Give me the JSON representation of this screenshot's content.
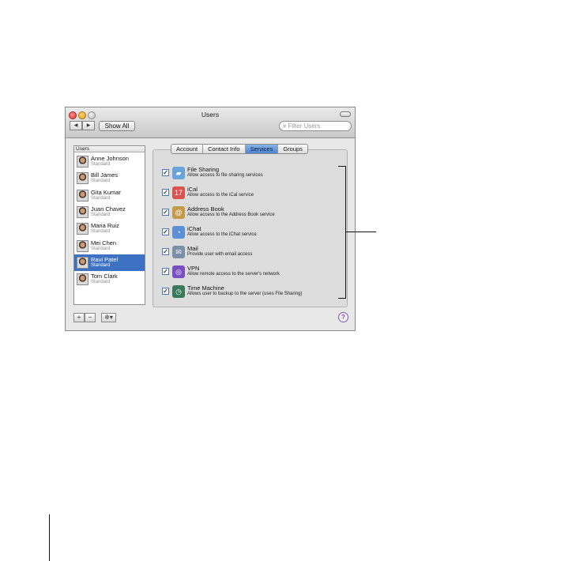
{
  "window": {
    "title": "Users",
    "show_all_label": "Show All",
    "back_glyph": "◀",
    "forward_glyph": "▶",
    "search_placeholder": "Filter Users",
    "search_icon": "magnifier-icon"
  },
  "user_list": {
    "header": "Users",
    "selected_index": 6,
    "users": [
      {
        "name": "Anne Johnson",
        "role": "Standard"
      },
      {
        "name": "Bill James",
        "role": "Standard"
      },
      {
        "name": "Gita Kumar",
        "role": "Standard"
      },
      {
        "name": "Juan Chavez",
        "role": "Standard"
      },
      {
        "name": "Maria Ruiz",
        "role": "Standard"
      },
      {
        "name": "Mei Chen",
        "role": "Standard"
      },
      {
        "name": "Ravi Patel",
        "role": "Standard"
      },
      {
        "name": "Tom Clark",
        "role": "Standard"
      }
    ]
  },
  "tabs": {
    "items": [
      "Account",
      "Contact Info",
      "Services",
      "Groups"
    ],
    "active": "Services"
  },
  "services": [
    {
      "name": "File Sharing",
      "desc": "Allow access to file sharing services",
      "checked": true,
      "icon": "folder-icon",
      "color": "#6aa3d9"
    },
    {
      "name": "iCal",
      "desc": "Allow access to the iCal service",
      "checked": true,
      "icon": "calendar-icon",
      "color": "#d9534f"
    },
    {
      "name": "Address Book",
      "desc": "Allow access to the Address Book service",
      "checked": true,
      "icon": "address-book-icon",
      "color": "#c49a4a"
    },
    {
      "name": "iChat",
      "desc": "Allow access to the iChat service",
      "checked": true,
      "icon": "chat-bubble-icon",
      "color": "#5b8fd8"
    },
    {
      "name": "Mail",
      "desc": "Provide user with email access",
      "checked": true,
      "icon": "mail-icon",
      "color": "#7a8fa8"
    },
    {
      "name": "VPN",
      "desc": "Allow remote access to the server's network",
      "checked": true,
      "icon": "vpn-icon",
      "color": "#7a4fc2"
    },
    {
      "name": "Time Machine",
      "desc": "Allows user to backup to the server (uses File Sharing)",
      "checked": true,
      "icon": "time-machine-icon",
      "color": "#3a7a5a"
    }
  ],
  "bottom_bar": {
    "add_glyph": "+",
    "remove_glyph": "−",
    "action_glyph": "✲▾",
    "help_glyph": "?"
  },
  "checkbox_glyph": "✓"
}
